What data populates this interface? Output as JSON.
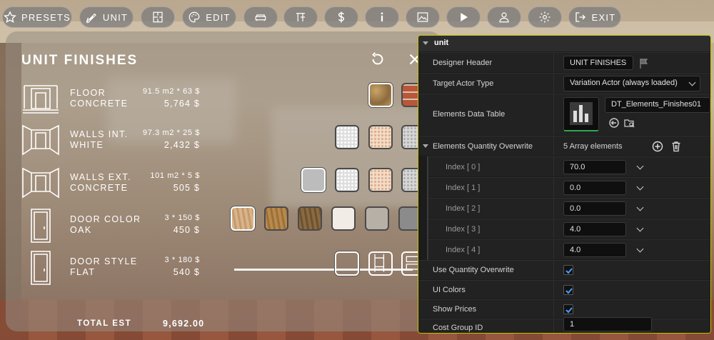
{
  "toolbar": {
    "presets": "PRESETS",
    "unit": "UNIT",
    "edit": "EDIT",
    "exit": "EXIT"
  },
  "panel": {
    "title": "UNIT FINISHES",
    "rows": [
      {
        "name": "FLOOR",
        "sub": "CONCRETE",
        "qty": "91.5 m2 * 63 $",
        "price": "5,764 $"
      },
      {
        "name": "WALLS INT.",
        "sub": "WHITE",
        "qty": "97.3 m2 * 25 $",
        "price": "2,432 $"
      },
      {
        "name": "WALLS EXT.",
        "sub": "CONCRETE",
        "qty": "101 m2 * 5 $",
        "price": "505 $"
      },
      {
        "name": "DOOR COLOR",
        "sub": "OAK",
        "qty": "3  * 150 $",
        "price": "450 $"
      },
      {
        "name": "DOOR STYLE",
        "sub": "FLAT",
        "qty": "3  * 180 $",
        "price": "540 $"
      }
    ],
    "total_label": "TOTAL EST",
    "total_value": "9,692.00"
  },
  "details": {
    "header": "unit",
    "designer_header_label": "Designer Header",
    "designer_header_value": "UNIT FINISHES",
    "target_actor_label": "Target Actor Type",
    "target_actor_value": "Variation Actor (always loaded)",
    "elements_table_label": "Elements Data Table",
    "elements_table_value": "DT_Elements_Finishes01",
    "quantity_overwrite_label": "Elements Quantity Overwrite",
    "quantity_overwrite_count": "5 Array elements",
    "indexes": [
      {
        "label": "Index [ 0 ]",
        "value": "70.0"
      },
      {
        "label": "Index [ 1 ]",
        "value": "0.0"
      },
      {
        "label": "Index [ 2 ]",
        "value": "0.0"
      },
      {
        "label": "Index [ 3 ]",
        "value": "4.0"
      },
      {
        "label": "Index [ 4 ]",
        "value": "4.0"
      }
    ],
    "use_quantity_label": "Use Quantity Overwrite",
    "use_quantity": true,
    "ui_colors_label": "UI Colors",
    "ui_colors": true,
    "show_prices_label": "Show Prices",
    "show_prices": true,
    "cost_group_label": "Cost Group ID",
    "cost_group_value": "1"
  },
  "colors": {
    "accent_border": "#c6c000",
    "check_blue": "#4a9eff"
  }
}
